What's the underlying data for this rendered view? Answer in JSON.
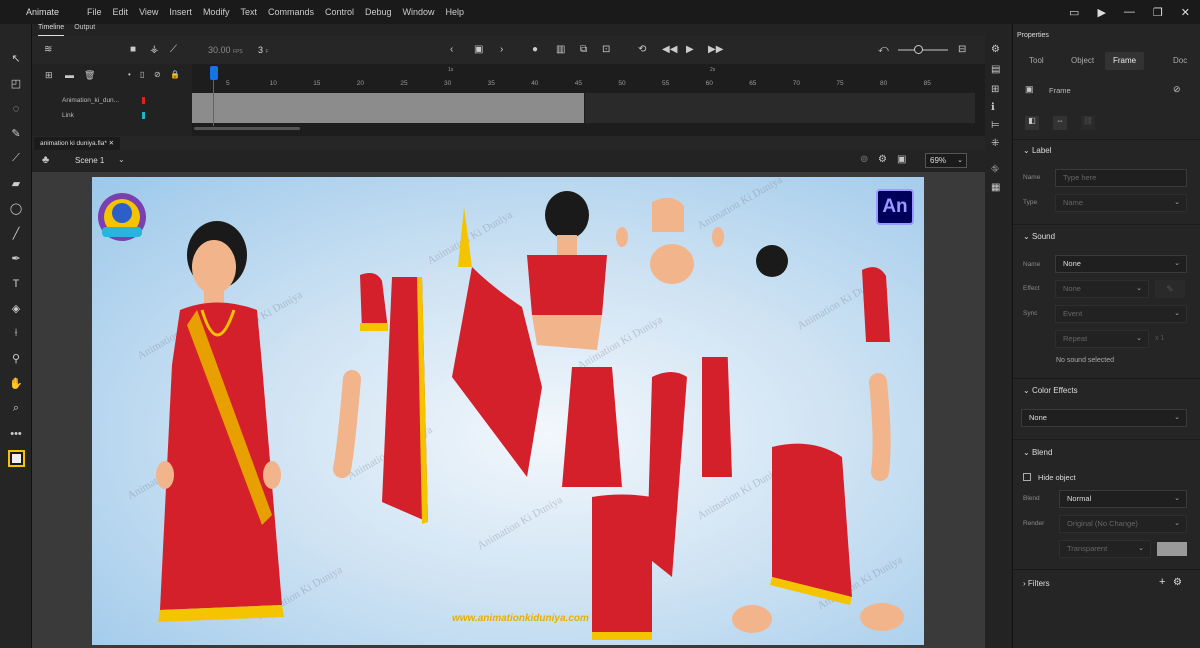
{
  "menubar": {
    "app_name": "Animate",
    "items": [
      "File",
      "Edit",
      "View",
      "Insert",
      "Modify",
      "Text",
      "Commands",
      "Control",
      "Debug",
      "Window",
      "Help"
    ]
  },
  "timeline": {
    "tabs": [
      "Timeline",
      "Output"
    ],
    "fps": "30.00",
    "fps_unit": "FPS",
    "current_frame": "3",
    "frame_unit": "F",
    "ruler_numbers": [
      "5",
      "10",
      "15",
      "20",
      "25",
      "30",
      "35",
      "40",
      "45",
      "50",
      "55",
      "60",
      "65",
      "70",
      "75",
      "80",
      "85"
    ],
    "ruler_seconds": [
      "1s",
      "2s"
    ],
    "layers": [
      {
        "name": "Animation_ki_dun...",
        "color": "#e02020"
      },
      {
        "name": "Link",
        "color": "#19b6c6"
      }
    ],
    "filled_frames": 45
  },
  "document": {
    "tab_label": "animation ki duniya.fla*",
    "scene_label": "Scene 1",
    "zoom": "69%"
  },
  "stage": {
    "watermark_text": "Animation Ki Duniya",
    "logo_text": "An",
    "url_text": "www.animationkiduniya.com"
  },
  "properties": {
    "title": "Properties",
    "tabs": [
      "Tool",
      "Object",
      "Frame",
      "Doc"
    ],
    "active_tab": "Frame",
    "frame_header": "Frame",
    "label_section": "Label",
    "name_label": "Name",
    "name_placeholder": "Type here",
    "type_label": "Type",
    "type_value": "Name",
    "sound_section": "Sound",
    "sound_name_label": "Name",
    "sound_name_value": "None",
    "effect_label": "Effect",
    "effect_value": "None",
    "sync_label": "Sync",
    "sync_value": "Event",
    "repeat_value": "Repeat",
    "repeat_count": "x 1",
    "no_sound": "No sound selected",
    "color_effects_section": "Color Effects",
    "color_effects_value": "None",
    "blend_section": "Blend",
    "hide_object_label": "Hide object",
    "blend_label": "Blend",
    "blend_value": "Normal",
    "render_label": "Render",
    "render_value": "Original (No Change)",
    "transparent_value": "Transparent",
    "filters_section": "Filters"
  },
  "colors": {
    "accent_blue": "#1473e6",
    "saree_red": "#d4202a",
    "border_yellow": "#f5c400"
  }
}
